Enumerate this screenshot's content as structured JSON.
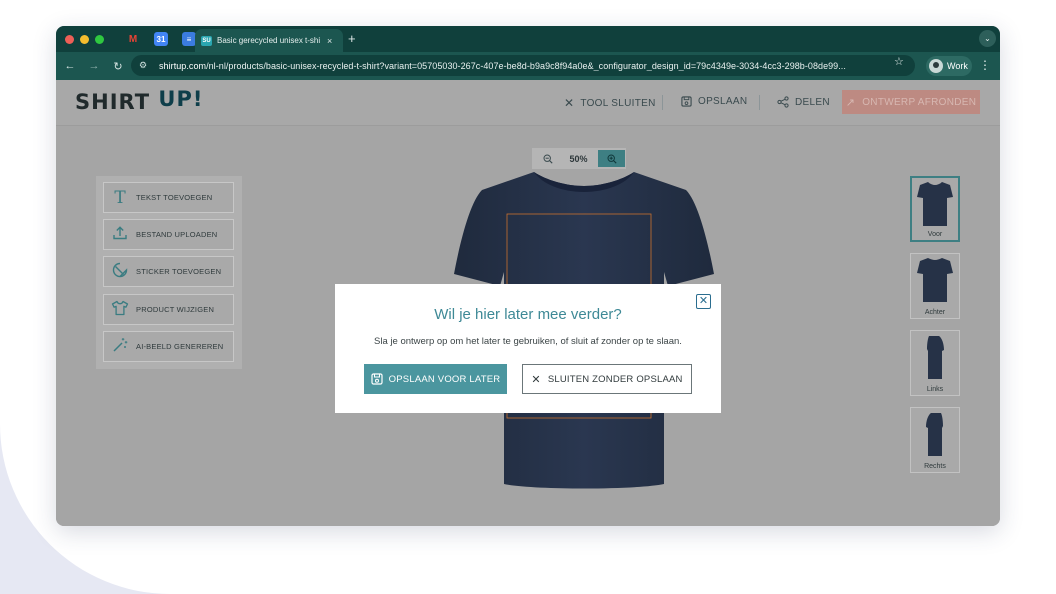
{
  "browser": {
    "tab_title": "Basic gerecycled unisex t-shi",
    "tab_close": "×",
    "new_tab": "+",
    "url_host": "shirtup.com",
    "url_path": "/nl-nl/products/basic-unisex-recycled-t-shirt?variant=05705030-267c-407e-be8d-b9a9c8f94a0e&_configurator_design_id=79c4349e-3034-4cc3-298b-08de99...",
    "profile_label": "Work",
    "pinned_tabs": [
      "M",
      "31",
      "≡"
    ]
  },
  "site": {
    "logo_left": "SHIRT",
    "logo_right": "UP!",
    "header_actions": [
      {
        "label": "TOOL SLUITEN",
        "icon": "close-icon"
      },
      {
        "label": "OPSLAAN",
        "icon": "floppy-disk-icon"
      },
      {
        "label": "DELEN",
        "icon": "share-icon"
      }
    ],
    "finish_label": "ONTWERP AFRONDEN"
  },
  "zoom": {
    "value": "50%"
  },
  "tools": [
    {
      "label": "TEKST TOEVOEGEN",
      "icon": "text-icon"
    },
    {
      "label": "BESTAND UPLOADEN",
      "icon": "upload-icon"
    },
    {
      "label": "STICKER TOEVOEGEN",
      "icon": "sticker-icon"
    },
    {
      "label": "PRODUCT WIJZIGEN",
      "icon": "tshirt-icon"
    },
    {
      "label": "AI-BEELD GENEREREN",
      "icon": "magic-wand-icon"
    }
  ],
  "views": [
    {
      "label": "Voor",
      "selected": true
    },
    {
      "label": "Achter",
      "selected": false
    },
    {
      "label": "Links",
      "selected": false
    },
    {
      "label": "Rechts",
      "selected": false
    }
  ],
  "modal": {
    "title": "Wil je hier later mee verder?",
    "text": "Sla je ontwerp op om het later te gebruiken, of sluit af zonder op te slaan.",
    "save_label": "OPSLAAN VOOR LATER",
    "close_label": "SLUITEN ZONDER OPSLAAN"
  },
  "colors": {
    "accent": "#4b969f",
    "shirt": "#263247",
    "chrome": "#10403c"
  }
}
